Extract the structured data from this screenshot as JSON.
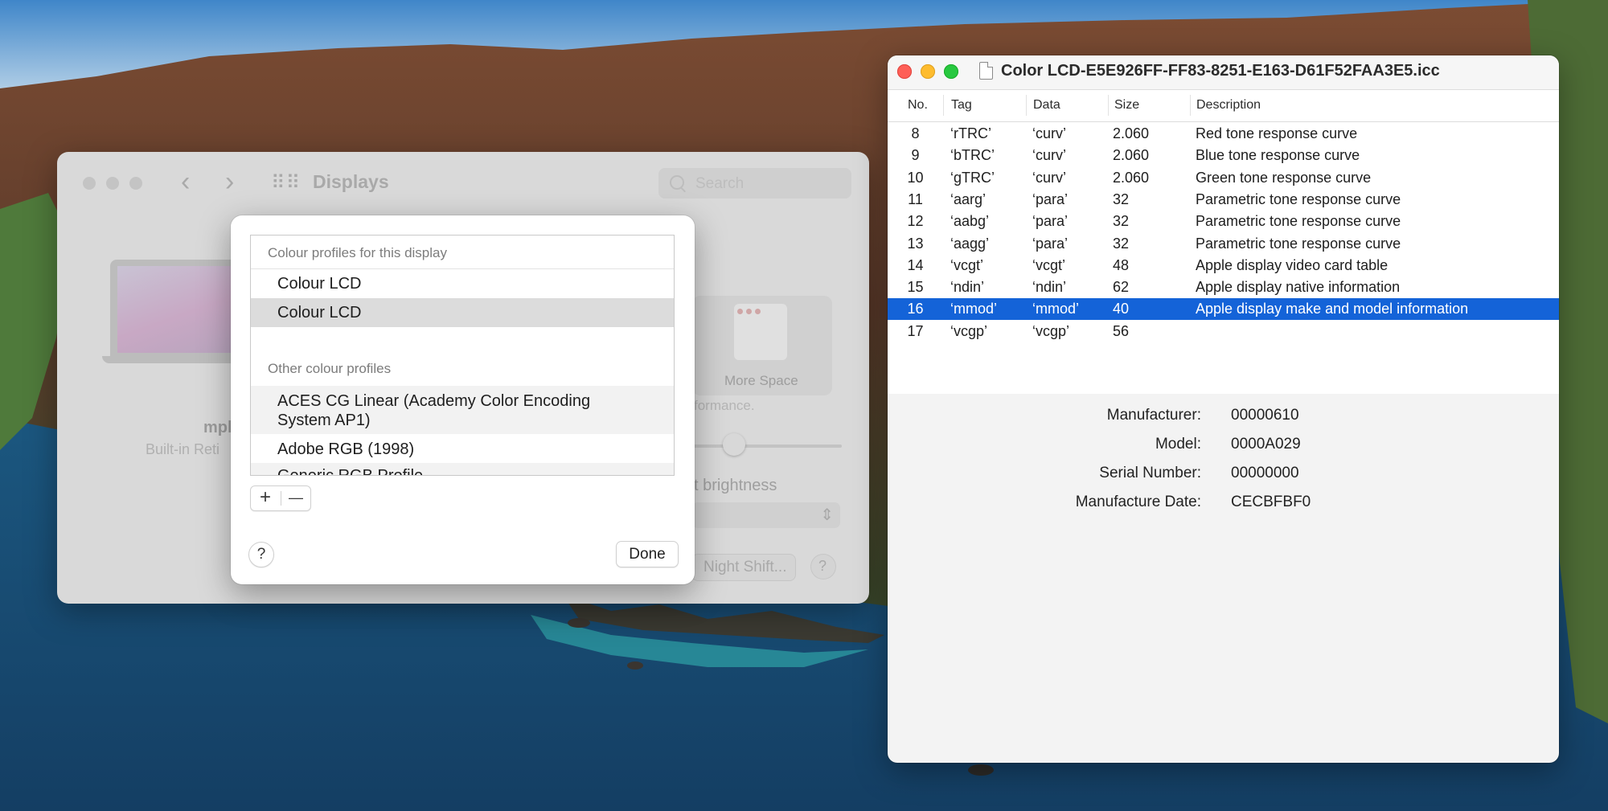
{
  "displays_window": {
    "title": "Displays",
    "search_placeholder": "Search",
    "display_name": "mpl",
    "display_subtitle": "Built-in Reti",
    "more_space_label": "More Space",
    "performance_fragment": "formance.",
    "brightness_fragment": "t brightness",
    "night_shift_label": "Night Shift...",
    "help_label": "?"
  },
  "profile_sheet": {
    "section_this_display": "Colour profiles for this display",
    "display_profiles": [
      "Colour LCD",
      "Colour LCD"
    ],
    "section_other": "Other colour profiles",
    "other_profiles": [
      "ACES CG Linear (Academy Color Encoding System AP1)",
      "Adobe RGB (1998)",
      "Generic RGB Profile"
    ],
    "add_label": "+",
    "remove_label": "—",
    "help_label": "?",
    "done_label": "Done"
  },
  "icc_window": {
    "title": "Color LCD-E5E926FF-FF83-8251-E163-D61F52FAA3E5.icc",
    "columns": [
      "No.",
      "Tag",
      "Data",
      "Size",
      "Description"
    ],
    "rows": [
      {
        "no": "8",
        "tag": "‘rTRC’",
        "data": "‘curv’",
        "size": "2.060",
        "desc": "Red tone response curve"
      },
      {
        "no": "9",
        "tag": "‘bTRC’",
        "data": "‘curv’",
        "size": "2.060",
        "desc": "Blue tone response curve"
      },
      {
        "no": "10",
        "tag": "‘gTRC’",
        "data": "‘curv’",
        "size": "2.060",
        "desc": "Green tone response curve"
      },
      {
        "no": "11",
        "tag": "‘aarg’",
        "data": "‘para’",
        "size": "32",
        "desc": "Parametric tone response curve"
      },
      {
        "no": "12",
        "tag": "‘aabg’",
        "data": "‘para’",
        "size": "32",
        "desc": "Parametric tone response curve"
      },
      {
        "no": "13",
        "tag": "‘aagg’",
        "data": "‘para’",
        "size": "32",
        "desc": "Parametric tone response curve"
      },
      {
        "no": "14",
        "tag": "‘vcgt’",
        "data": "‘vcgt’",
        "size": "48",
        "desc": "Apple display video card table"
      },
      {
        "no": "15",
        "tag": "‘ndin’",
        "data": "‘ndin’",
        "size": "62",
        "desc": "Apple display native information"
      },
      {
        "no": "16",
        "tag": "‘mmod’",
        "data": "‘mmod’",
        "size": "40",
        "desc": "Apple display make and model information"
      },
      {
        "no": "17",
        "tag": "‘vcgp’",
        "data": "‘vcgp’",
        "size": "56",
        "desc": ""
      }
    ],
    "selected_row": "16",
    "details": [
      {
        "label": "Manufacturer:",
        "value": "00000610"
      },
      {
        "label": "Model:",
        "value": "0000A029"
      },
      {
        "label": "Serial Number:",
        "value": "00000000"
      },
      {
        "label": "Manufacture Date:",
        "value": "CECBFBF0"
      }
    ]
  },
  "colors": {
    "selection": "#1463d8",
    "close": "#fe5f57",
    "minimize": "#febc2e",
    "zoom": "#28c840"
  }
}
